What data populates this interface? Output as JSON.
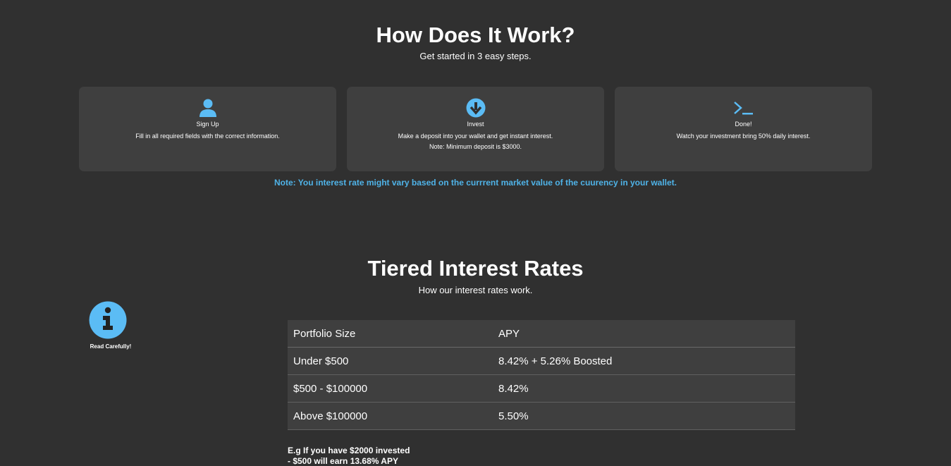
{
  "how": {
    "title": "How Does It Work?",
    "subtitle": "Get started in 3 easy steps.",
    "steps": [
      {
        "icon": "user-icon",
        "title": "Sign Up",
        "desc": "Fill in all required fields with the correct information.",
        "desc2": ""
      },
      {
        "icon": "arrow-down-circle-icon",
        "title": "Invest",
        "desc": "Make a deposit into your wallet and get instant interest.",
        "desc2": "Note: Minimum deposit is $3000."
      },
      {
        "icon": "terminal-icon",
        "title": "Done!",
        "desc": "Watch your investment bring 50% daily interest.",
        "desc2": ""
      }
    ],
    "note": "Note: You interest rate might vary based on the currrent market value of the cuurency in your wallet."
  },
  "tiered": {
    "title": "Tiered Interest Rates",
    "subtitle": "How our interest rates work.",
    "info_label": "Read Carefully!",
    "headers": [
      "Portfolio Size",
      "APY"
    ],
    "rows": [
      [
        "Under $500",
        "8.42% + 5.26% Boosted"
      ],
      [
        "$500 - $100000",
        "8.42%"
      ],
      [
        "Above $100000",
        "5.50%"
      ]
    ],
    "example_line1": "E.g If you have $2000 invested",
    "example_line2": "- $500 will earn 13.68% APY"
  },
  "colors": {
    "background": "#303030",
    "card": "#3f3f3f",
    "accent": "#5bbcf5",
    "note": "#4fb3e8"
  }
}
